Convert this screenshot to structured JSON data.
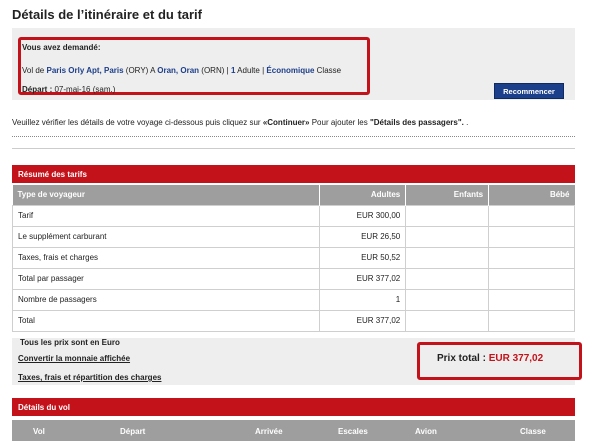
{
  "header": {
    "title": "Détails de l’itinéraire et du tarif"
  },
  "request": {
    "heading": "Vous avez demandé:",
    "line_prefix": "Vol de",
    "origin": "Paris Orly Apt, Paris",
    "origin_code": "(ORY)",
    "to_word": "A",
    "destination": "Oran, Oran",
    "destination_code": "(ORN)",
    "sep1": "|",
    "passengers_count": "1",
    "passengers_label": "Adulte",
    "sep2": "|",
    "cabin": "Économique",
    "cabin_suffix": "Classe",
    "depart_label": "Départ :",
    "depart_date": "07-mai-16 (sam.)",
    "restart_label": "Recommencer"
  },
  "instruction": {
    "before": "Veuillez vérifier les détails de votre voyage ci-dessous puis cliquez sur",
    "continue": "«Continuer»",
    "middle": "Pour ajouter les",
    "passenger_details": "\"Détails des passagers\".",
    "after": "."
  },
  "fares": {
    "section_title": "Résumé des tarifs",
    "columns": [
      "Type de voyageur",
      "Adultes",
      "Enfants",
      "Bébé"
    ],
    "rows": [
      {
        "label": "Tarif",
        "adultes": "EUR 300,00",
        "enfants": "",
        "bebe": ""
      },
      {
        "label": "Le supplément carburant",
        "adultes": "EUR 26,50",
        "enfants": "",
        "bebe": ""
      },
      {
        "label": "Taxes, frais et charges",
        "adultes": "EUR 50,52",
        "enfants": "",
        "bebe": ""
      },
      {
        "label": "Total par passager",
        "adultes": "EUR 377,02",
        "enfants": "",
        "bebe": ""
      },
      {
        "label": "Nombre de passagers",
        "adultes": "1",
        "enfants": "",
        "bebe": ""
      },
      {
        "label": "Total",
        "adultes": "EUR 377,02",
        "enfants": "",
        "bebe": ""
      }
    ],
    "note": "Tous les prix sont en Euro",
    "convert_link": "Convertir la monnaie affichée",
    "taxes_link": "Taxes, frais et répartition des charges",
    "total_label": "Prix total :",
    "total_amount": "EUR 377,02"
  },
  "flight": {
    "section_title": "Détails du vol",
    "columns": [
      "Vol",
      "Départ",
      "Arrivée",
      "Escales",
      "Avion",
      "Classe"
    ]
  },
  "colors": {
    "accent_red": "#c4121a",
    "header_gray": "#9e9e9e",
    "button_blue": "#1b3f8b",
    "link_blue": "#1d3f8a"
  }
}
